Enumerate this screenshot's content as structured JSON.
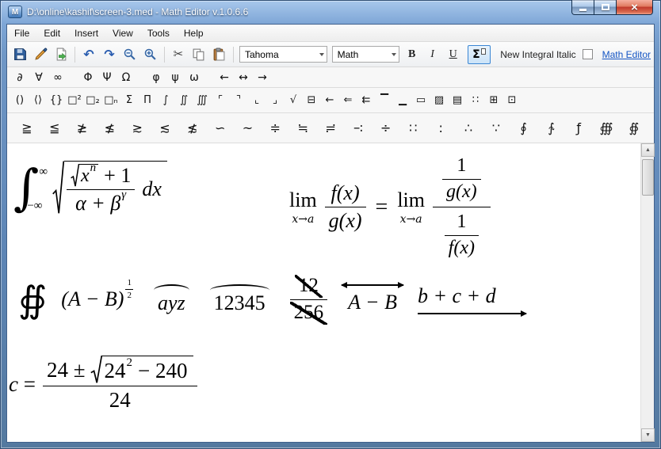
{
  "window": {
    "title": "D:\\online\\kashif\\screen-3.med - Math Editor v.1.0.6.6",
    "app_initial": "M",
    "close_glyph": "×"
  },
  "menu": {
    "items": [
      "File",
      "Edit",
      "Insert",
      "View",
      "Tools",
      "Help"
    ]
  },
  "toolbar": {
    "font_name": "Tahoma",
    "style_name": "Math",
    "bold": "B",
    "italic": "I",
    "underline": "U",
    "sigma": "Σ",
    "undo": "↶",
    "redo": "↷",
    "cut": "✂",
    "new_integral_italic": "New Integral Italic",
    "link": "Math Editor",
    "accent_color": "#3a86d4",
    "link_color": "#1556c4"
  },
  "symbols": {
    "row1": [
      "∂",
      "∀",
      "∞",
      "Φ",
      "Ψ",
      "Ω",
      "φ",
      "ψ",
      "ω",
      "←",
      "↔",
      "→"
    ],
    "row2": [
      "()",
      "⟨⟩",
      "{}",
      "□²",
      "□₂",
      "□ₙ",
      "Σ",
      "Π",
      "∫",
      "∬",
      "∭",
      "⌜",
      "⌝",
      "⌞",
      "⌟",
      "√",
      "⊟",
      "←",
      "⇐",
      "⇇",
      "▔",
      "▁",
      "▭",
      "▨",
      "▤",
      "∷",
      "⊞",
      "⊡"
    ],
    "row3": [
      "≧",
      "≦",
      "≱",
      "≰",
      "≳",
      "≲",
      "≴",
      "∽",
      "~",
      "≑",
      "≒",
      "≓",
      "∹",
      "÷",
      "∷",
      ":",
      "∴",
      "∵",
      "∮",
      "∱",
      "ƒ",
      "∰",
      "∯"
    ]
  },
  "scrollbar": {
    "up": "▲",
    "down": "▼"
  },
  "formulas": {
    "f1": {
      "int_sign": "∫",
      "upper_limit": "∞",
      "lower_limit": "−∞",
      "inner_radicand": "x",
      "inner_exp": "n",
      "num_tail": "+ 1",
      "den_main": "α + β",
      "den_exp": "γ",
      "differential": "dx"
    },
    "f2": {
      "lim1": "lim",
      "lim1_sub": "x→a",
      "num1": "f(x)",
      "den1": "g(x)",
      "equals": "=",
      "lim2": "lim",
      "lim2_sub": "x→a",
      "top_num": "1",
      "top_den": "g(x)",
      "bot_num": "1",
      "bot_den": "f(x)"
    },
    "f3": {
      "contour": "∯",
      "paren": "(A − B)",
      "exp_num": "1",
      "exp_den": "2",
      "arc1": "ayz",
      "arc2": "12345",
      "cancel_num": "12",
      "cancel_den": "256",
      "overarrow_text": "A − B",
      "underarrow_text": "b + c + d"
    },
    "f4": {
      "lhs_var": "c",
      "lhs_eq": "=",
      "num_head": "24 ±",
      "rad_base": "24",
      "rad_exp": "2",
      "rad_tail": "− 240",
      "den": "24"
    }
  }
}
